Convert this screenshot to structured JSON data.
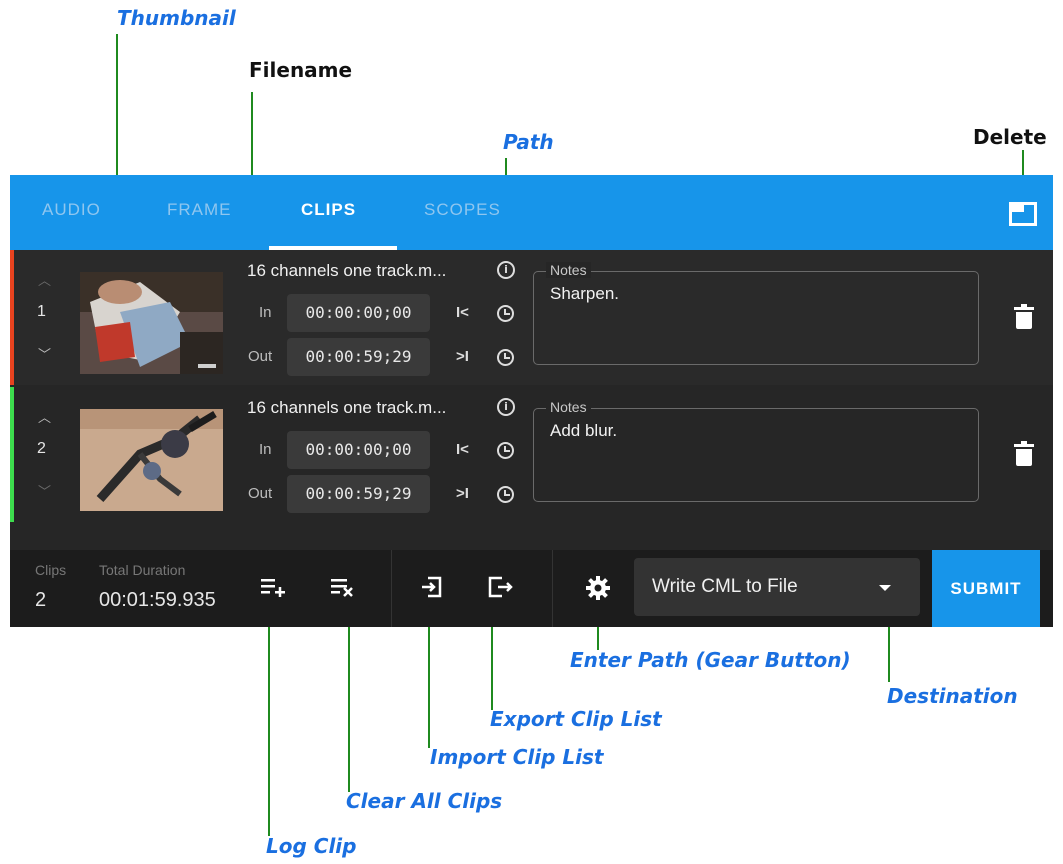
{
  "callouts": {
    "thumbnail": "Thumbnail",
    "filename": "Filename",
    "path": "Path",
    "delete": "Delete",
    "enter_path": "Enter Path (Gear Button)",
    "destination": "Destination",
    "export_clip_list": "Export Clip List",
    "import_clip_list": "Import Clip List",
    "clear_all_clips": "Clear All Clips",
    "log_clip": "Log Clip"
  },
  "tabs": [
    {
      "label": "AUDIO"
    },
    {
      "label": "FRAME"
    },
    {
      "label": "CLIPS",
      "active": true
    },
    {
      "label": "SCOPES"
    }
  ],
  "clips": [
    {
      "number": "1",
      "filename": "16 channels one track.m...",
      "in_label": "In",
      "in_time": "00:00:00;00",
      "out_label": "Out",
      "out_time": "00:00:59;29",
      "notes_label": "Notes",
      "notes": "Sharpen.",
      "stripe_color": "#e8431f"
    },
    {
      "number": "2",
      "filename": "16 channels one track.m...",
      "in_label": "In",
      "in_time": "00:00:00;00",
      "out_label": "Out",
      "out_time": "00:00:59;29",
      "notes_label": "Notes",
      "notes": "Add blur.",
      "stripe_color": "#3ddc4d"
    }
  ],
  "footer": {
    "clips_label": "Clips",
    "clips_count": "2",
    "duration_label": "Total Duration",
    "duration_value": "00:01:59.935",
    "destination": "Write CML to File",
    "submit": "SUBMIT"
  },
  "colors": {
    "accent": "#1795ea",
    "callout_blue": "#1a6fe0",
    "leader_green": "#1f8a1f"
  }
}
